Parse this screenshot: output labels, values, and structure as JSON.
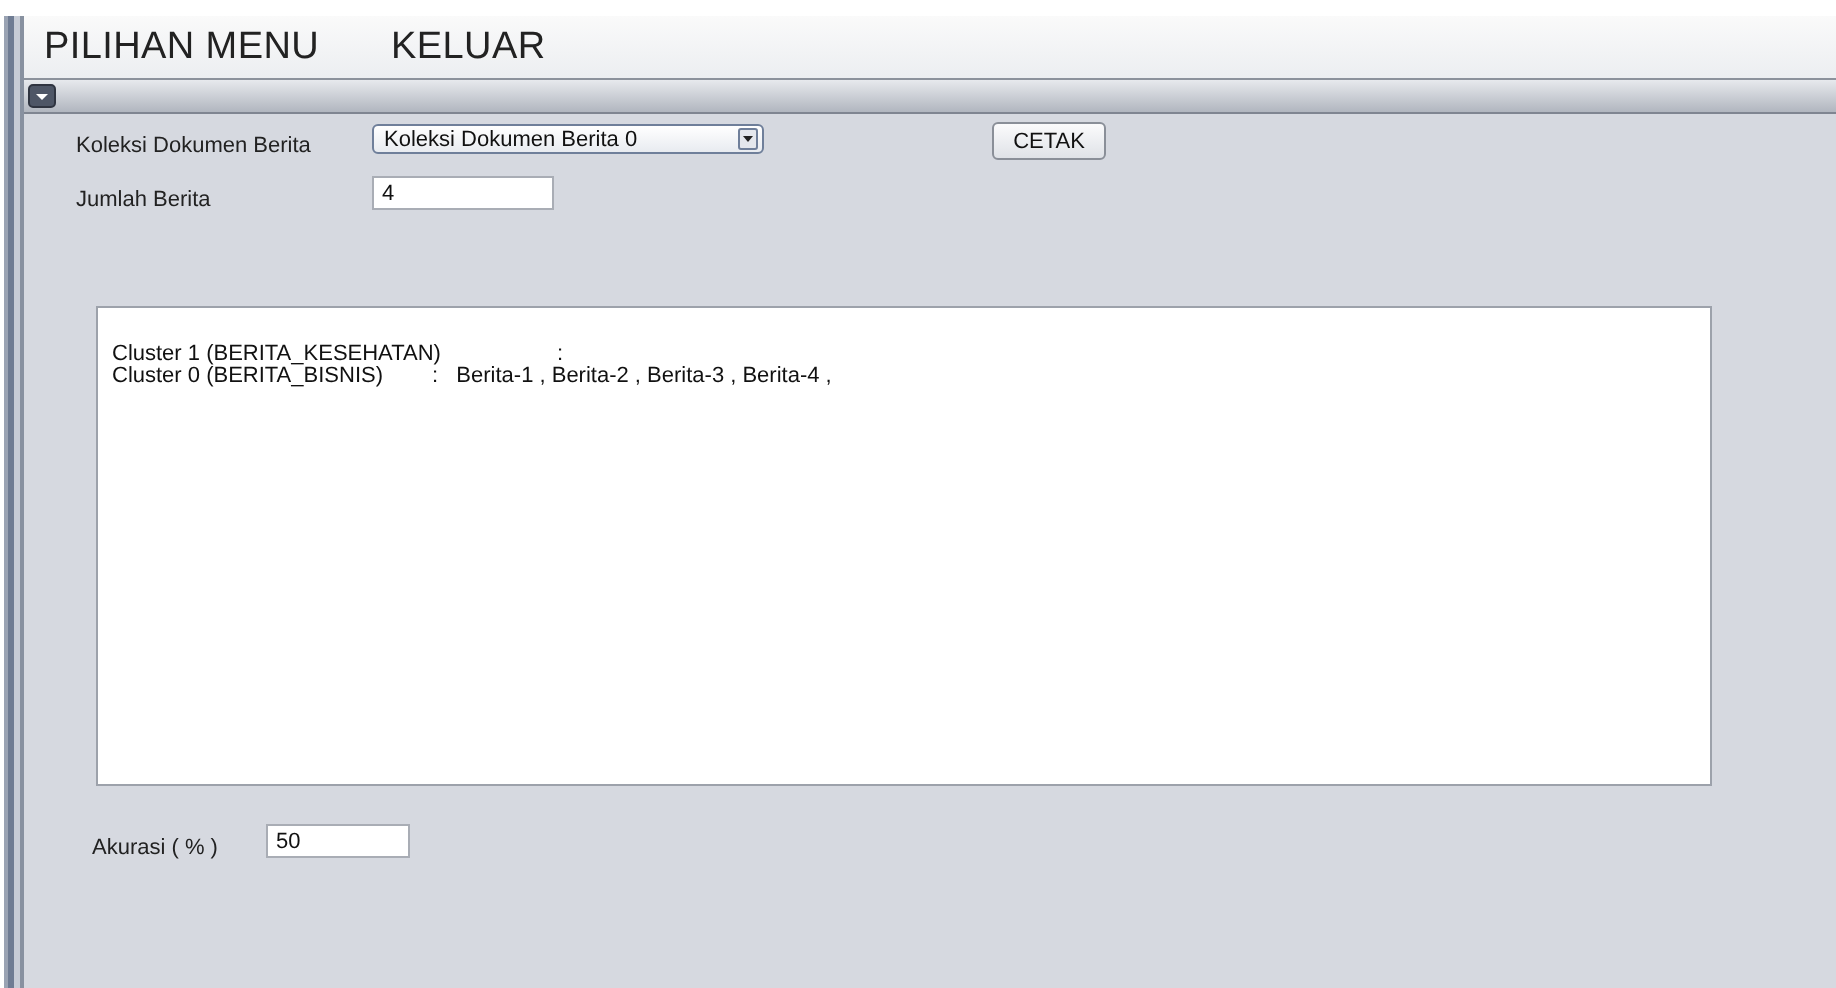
{
  "menu_bar": {
    "items": [
      {
        "label": "PILIHAN MENU"
      },
      {
        "label": "KELUAR"
      }
    ]
  },
  "form": {
    "collection_label": "Koleksi Dokumen Berita",
    "collection_value": "Koleksi Dokumen Berita 0",
    "print_button": "CETAK",
    "count_label": "Jumlah Berita",
    "count_value": "4"
  },
  "result_lines": [
    "Cluster 1 (BERITA_KESEHATAN)                   :",
    "Cluster 0 (BERITA_BISNIS)        :   Berita-1 , Berita-2 , Berita-3 , Berita-4 ,"
  ],
  "accuracy": {
    "label": "Akurasi ( % )",
    "value": "50"
  }
}
